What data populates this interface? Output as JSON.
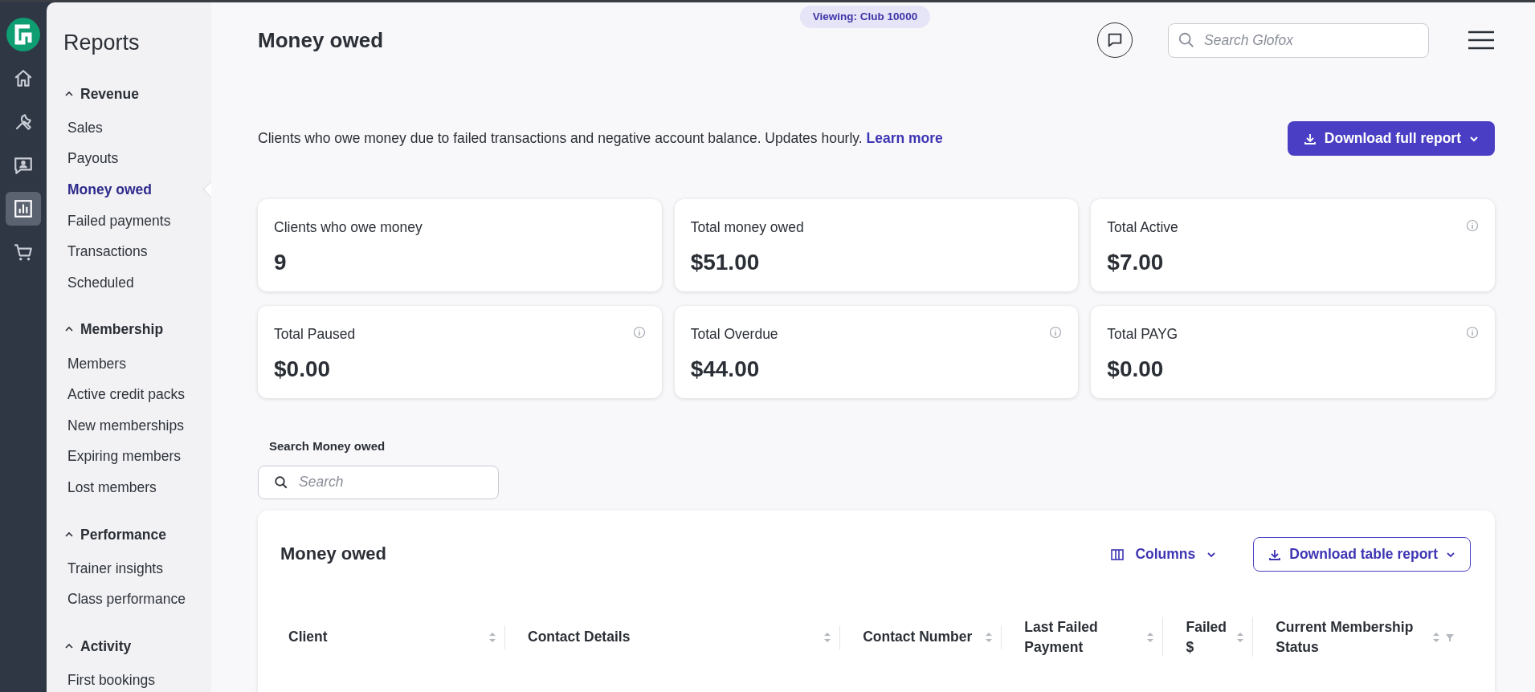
{
  "rail": {
    "items": [
      {
        "kind": "home",
        "selected": false
      },
      {
        "kind": "tools",
        "selected": false
      },
      {
        "kind": "contacts",
        "selected": false
      },
      {
        "kind": "reports",
        "selected": true
      },
      {
        "kind": "store",
        "selected": false
      }
    ]
  },
  "sidebar": {
    "title": "Reports",
    "groups": [
      {
        "label": "Revenue",
        "expanded": true,
        "items": [
          {
            "label": "Sales",
            "selected": false
          },
          {
            "label": "Payouts",
            "selected": false
          },
          {
            "label": "Money owed",
            "selected": true
          },
          {
            "label": "Failed payments",
            "selected": false
          },
          {
            "label": "Transactions",
            "selected": false
          },
          {
            "label": "Scheduled",
            "selected": false
          }
        ]
      },
      {
        "label": "Membership",
        "expanded": true,
        "items": [
          {
            "label": "Members",
            "selected": false
          },
          {
            "label": "Active credit packs",
            "selected": false
          },
          {
            "label": "New memberships",
            "selected": false
          },
          {
            "label": "Expiring members",
            "selected": false
          },
          {
            "label": "Lost members",
            "selected": false
          }
        ]
      },
      {
        "label": "Performance",
        "expanded": true,
        "items": [
          {
            "label": "Trainer insights",
            "selected": false
          },
          {
            "label": "Class performance",
            "selected": false
          }
        ]
      },
      {
        "label": "Activity",
        "expanded": true,
        "items": [
          {
            "label": "First bookings",
            "selected": false
          }
        ]
      }
    ]
  },
  "header": {
    "viewing_badge": "Viewing: Club 10000",
    "title": "Money owed",
    "search": {
      "placeholder": "Search Glofox"
    }
  },
  "description": {
    "text": "Clients who owe money due to failed transactions and negative account balance. Updates hourly.",
    "link": "Learn more"
  },
  "download_button": "Download full report",
  "stats": [
    {
      "label": "Clients who owe money",
      "value": "9",
      "info": false
    },
    {
      "label": "Total money owed",
      "value": "$51.00",
      "info": false
    },
    {
      "label": "Total Active",
      "value": "$7.00",
      "info": true
    },
    {
      "label": "Total Paused",
      "value": "$0.00",
      "info": true
    },
    {
      "label": "Total Overdue",
      "value": "$44.00",
      "info": true
    },
    {
      "label": "Total PAYG",
      "value": "$0.00",
      "info": true
    }
  ],
  "table_search": {
    "label": "Search Money owed",
    "placeholder": "Search"
  },
  "table": {
    "title": "Money owed",
    "columns_button": "Columns",
    "download_button": "Download table report",
    "columns": [
      {
        "label": "Client",
        "sortable": true,
        "filter": false
      },
      {
        "label": "Contact Details",
        "sortable": true,
        "filter": false
      },
      {
        "label": "Contact Number",
        "sortable": true,
        "filter": false
      },
      {
        "label": "Last Failed Payment",
        "sortable": true,
        "filter": false
      },
      {
        "label": "Failed $",
        "sortable": true,
        "filter": false
      },
      {
        "label": "Current Membership Status",
        "sortable": true,
        "filter": true
      }
    ]
  }
}
